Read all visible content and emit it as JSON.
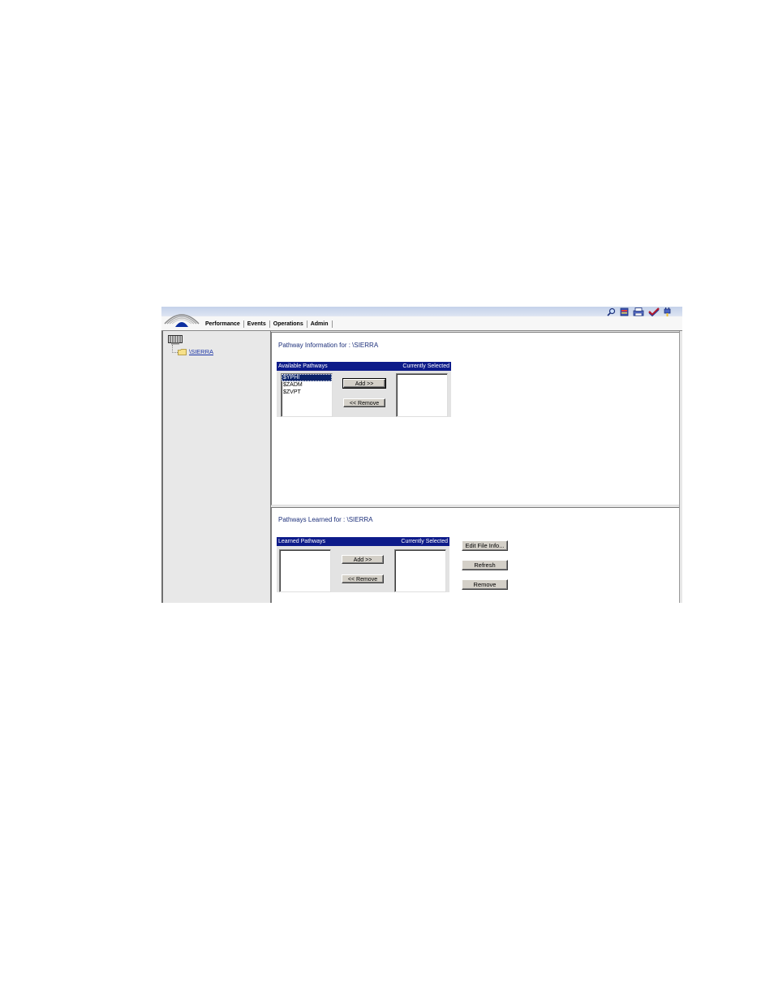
{
  "nav": {
    "tabs": [
      {
        "label": "Performance"
      },
      {
        "label": "Events"
      },
      {
        "label": "Operations"
      },
      {
        "label": "Admin"
      }
    ]
  },
  "toolbar": {
    "icons": [
      "search-icon",
      "book-icon",
      "print-icon",
      "checkmark-icon",
      "plug-icon"
    ]
  },
  "tree": {
    "root_icon": "server-icon",
    "node": {
      "label": "\\SIERRA"
    }
  },
  "pathway_info": {
    "title": "Pathway Information for : \\SIERRA",
    "available_header": "Available Pathways",
    "selected_header": "Currently Selected",
    "available_items": [
      "$YPHI",
      "$ZADM",
      "$ZVPT"
    ],
    "selected_item_index": 0,
    "add_label": "Add >>",
    "remove_label": "<< Remove"
  },
  "pathways_learned": {
    "title": "Pathways Learned for : \\SIERRA",
    "learned_header": "Learned Pathways",
    "selected_header": "Currently Selected",
    "add_label": "Add >>",
    "remove_label": "<< Remove",
    "edit_label": "Edit File Info...",
    "refresh_label": "Refresh",
    "remove_side_label": "Remove"
  },
  "colors": {
    "header_blue": "#0d1b8a",
    "title_blue": "#1c2f7a",
    "link_blue": "#1a33a5",
    "selection": "#0a246a"
  }
}
